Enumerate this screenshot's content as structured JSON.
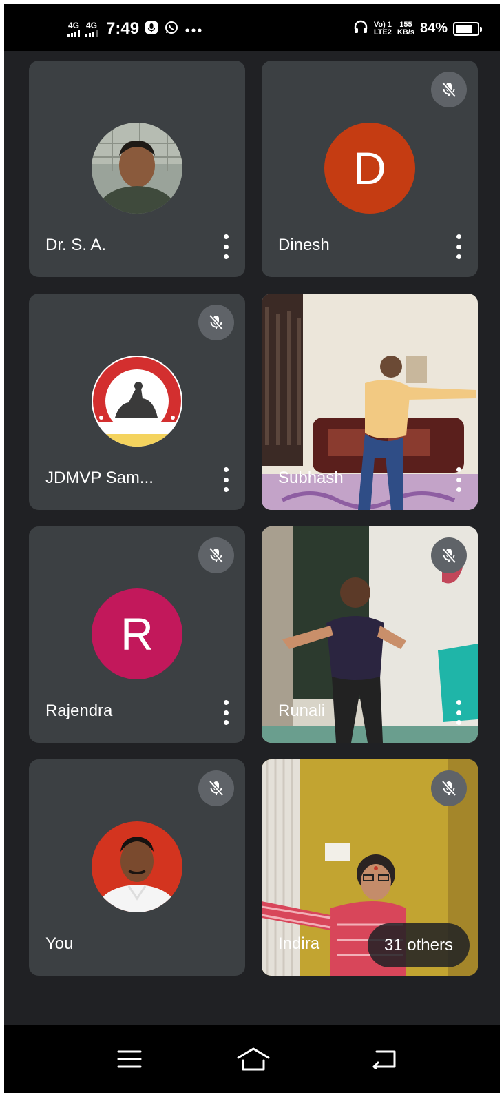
{
  "status_bar": {
    "network1": "4G",
    "network2": "4G",
    "time": "7:49",
    "volte_line1": "Vo) 1",
    "volte_line2": "LTE2",
    "speed_value": "155",
    "speed_unit": "KB/s",
    "battery_percent": "84%",
    "battery_level": 0.84
  },
  "participants": [
    {
      "name": "Dr. S. A.",
      "muted": false,
      "avatar": "photo"
    },
    {
      "name": "Dinesh",
      "muted": true,
      "avatar_letter": "D",
      "avatar_color": "#c53c12"
    },
    {
      "name": "JDMVP Sam...",
      "muted": true,
      "avatar": "logo"
    },
    {
      "name": "Subhash",
      "muted": false,
      "video": true
    },
    {
      "name": "Rajendra",
      "muted": true,
      "avatar_letter": "R",
      "avatar_color": "#c2185b"
    },
    {
      "name": "Runali",
      "muted": true,
      "video": true
    },
    {
      "name": "You",
      "muted": true,
      "avatar": "photo"
    },
    {
      "name": "Indira",
      "muted": true,
      "video": true
    }
  ],
  "others_chip": "31 others",
  "icons": {
    "mute": "mic-off-icon",
    "more": "more-vert-icon",
    "nav_menu": "menu-icon",
    "nav_home": "home-icon",
    "nav_back": "back-icon"
  }
}
